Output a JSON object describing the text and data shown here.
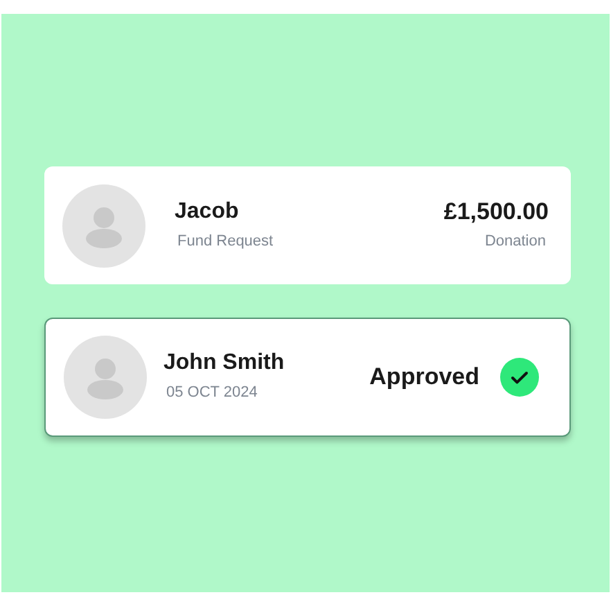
{
  "cards": [
    {
      "kind": "amount",
      "name": "Jacob",
      "subtitle": "Fund Request",
      "amount": "£1,500.00",
      "amount_label": "Donation",
      "selected": false
    },
    {
      "kind": "status",
      "name": "John Smith",
      "subtitle": "05 OCT 2024",
      "status": "Approved",
      "checked": true,
      "selected": true
    }
  ]
}
